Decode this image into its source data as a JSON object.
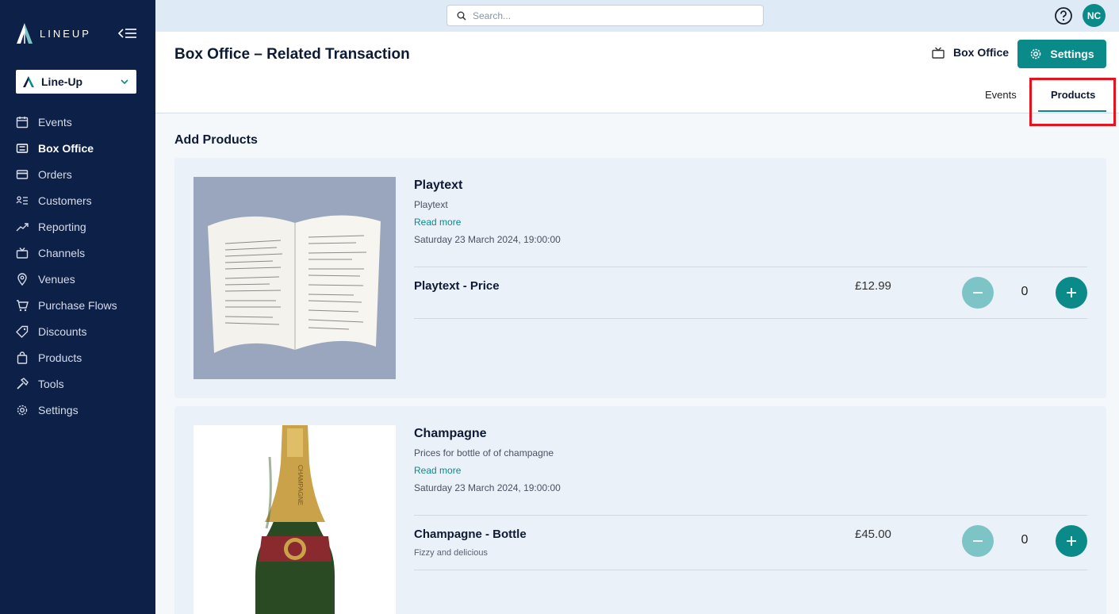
{
  "app": {
    "logo_text": "LINEUP",
    "org_selector": "Line-Up"
  },
  "sidebar": {
    "items": [
      {
        "label": "Events",
        "icon": "calendar-icon"
      },
      {
        "label": "Box Office",
        "icon": "ticket-icon",
        "active": true
      },
      {
        "label": "Orders",
        "icon": "credit-card-icon"
      },
      {
        "label": "Customers",
        "icon": "customers-list-icon"
      },
      {
        "label": "Reporting",
        "icon": "chart-line-icon"
      },
      {
        "label": "Channels",
        "icon": "tv-icon"
      },
      {
        "label": "Venues",
        "icon": "map-pin-icon"
      },
      {
        "label": "Purchase Flows",
        "icon": "cart-icon"
      },
      {
        "label": "Discounts",
        "icon": "tag-icon"
      },
      {
        "label": "Products",
        "icon": "shopping-bag-icon"
      },
      {
        "label": "Tools",
        "icon": "hammer-icon"
      },
      {
        "label": "Settings",
        "icon": "gear-icon"
      }
    ]
  },
  "topbar": {
    "search_placeholder": "Search...",
    "avatar_initials": "NC"
  },
  "header": {
    "title": "Box Office – Related Transaction",
    "channel_label": "Box Office",
    "settings_label": "Settings",
    "tabs": [
      {
        "label": "Events",
        "active": false
      },
      {
        "label": "Products",
        "active": true
      }
    ]
  },
  "content": {
    "section_title": "Add Products",
    "products": [
      {
        "name": "Playtext",
        "description": "Playtext",
        "read_more": "Read more",
        "date": "Saturday 23 March 2024, 19:00:00",
        "prices": [
          {
            "name": "Playtext - Price",
            "subtitle": "",
            "amount": "£12.99",
            "quantity": "0"
          }
        ]
      },
      {
        "name": "Champagne",
        "description": "Prices for bottle of of champagne",
        "read_more": "Read more",
        "date": "Saturday 23 March 2024, 19:00:00",
        "prices": [
          {
            "name": "Champagne - Bottle",
            "subtitle": "Fizzy and delicious",
            "amount": "£45.00",
            "quantity": "0"
          }
        ]
      }
    ]
  },
  "colors": {
    "sidebar_bg": "#0d2047",
    "accent": "#0b8a8a",
    "accent_light": "#7cc4c6",
    "highlight": "#e8121c",
    "card_bg": "#eaf1f8",
    "topbar_bg": "#deeaf6"
  }
}
